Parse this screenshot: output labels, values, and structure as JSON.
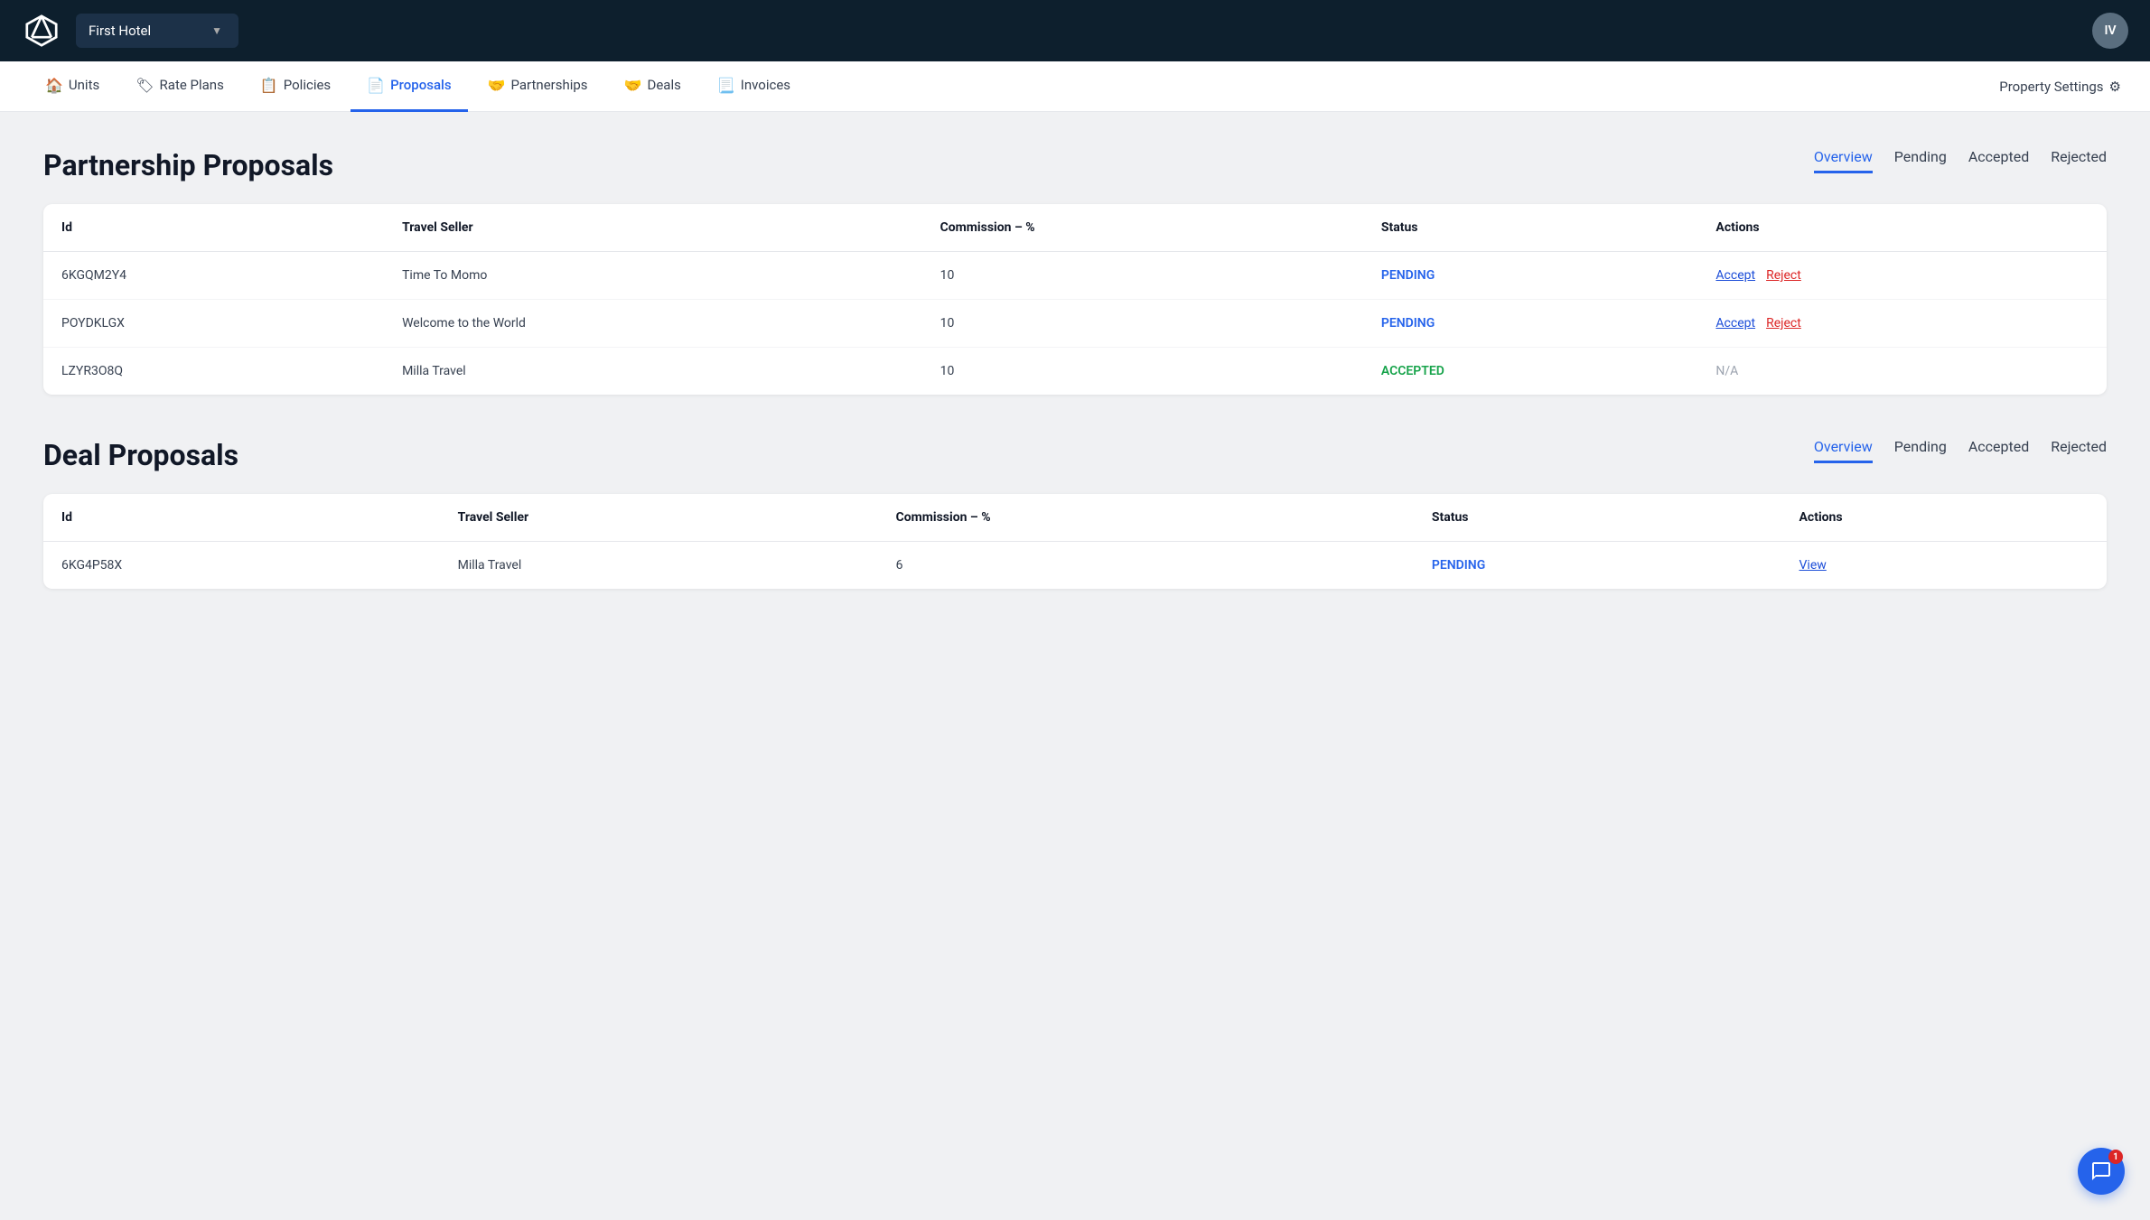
{
  "topbar": {
    "hotel_name": "First Hotel",
    "hotel_selector_arrow": "▼",
    "avatar_initials": "IV"
  },
  "subnav": {
    "items": [
      {
        "id": "units",
        "label": "Units",
        "icon": "🏠",
        "active": false
      },
      {
        "id": "rate-plans",
        "label": "Rate Plans",
        "icon": "🏷",
        "active": false
      },
      {
        "id": "policies",
        "label": "Policies",
        "icon": "📋",
        "active": false
      },
      {
        "id": "proposals",
        "label": "Proposals",
        "icon": "📄",
        "active": true
      },
      {
        "id": "partnerships",
        "label": "Partnerships",
        "icon": "🤝",
        "active": false
      },
      {
        "id": "deals",
        "label": "Deals",
        "icon": "🤝",
        "active": false
      },
      {
        "id": "invoices",
        "label": "Invoices",
        "icon": "📃",
        "active": false
      }
    ],
    "property_settings": "Property Settings",
    "gear_icon": "⚙"
  },
  "partnership_proposals": {
    "title": "Partnership Proposals",
    "tabs": [
      {
        "id": "overview",
        "label": "Overview",
        "active": true
      },
      {
        "id": "pending",
        "label": "Pending",
        "active": false
      },
      {
        "id": "accepted",
        "label": "Accepted",
        "active": false
      },
      {
        "id": "rejected",
        "label": "Rejected",
        "active": false
      }
    ],
    "table": {
      "columns": [
        "Id",
        "Travel Seller",
        "Commission – %",
        "Status",
        "Actions"
      ],
      "rows": [
        {
          "id": "6KGQM2Y4",
          "travel_seller": "Time To Momo",
          "commission": "10",
          "status": "PENDING",
          "status_type": "pending",
          "actions": [
            "accept",
            "reject"
          ]
        },
        {
          "id": "POYDKLGX",
          "travel_seller": "Welcome to the World",
          "commission": "10",
          "status": "PENDING",
          "status_type": "pending",
          "actions": [
            "accept",
            "reject"
          ]
        },
        {
          "id": "LZYR3O8Q",
          "travel_seller": "Milla Travel",
          "commission": "10",
          "status": "ACCEPTED",
          "status_type": "accepted",
          "actions": [
            "na"
          ]
        }
      ]
    },
    "action_labels": {
      "accept": "Accept",
      "reject": "Reject",
      "na": "N/A"
    }
  },
  "deal_proposals": {
    "title": "Deal Proposals",
    "tabs": [
      {
        "id": "overview",
        "label": "Overview",
        "active": true
      },
      {
        "id": "pending",
        "label": "Pending",
        "active": false
      },
      {
        "id": "accepted",
        "label": "Accepted",
        "active": false
      },
      {
        "id": "rejected",
        "label": "Rejected",
        "active": false
      }
    ],
    "table": {
      "columns": [
        "Id",
        "Travel Seller",
        "Commission – %",
        "Status",
        "Actions"
      ],
      "rows": [
        {
          "id": "6KG4P58X",
          "travel_seller": "Milla Travel",
          "commission": "6",
          "status": "PENDING",
          "status_type": "pending",
          "actions": [
            "view"
          ]
        }
      ]
    },
    "action_labels": {
      "view": "View"
    }
  },
  "chat": {
    "badge_count": "1"
  }
}
